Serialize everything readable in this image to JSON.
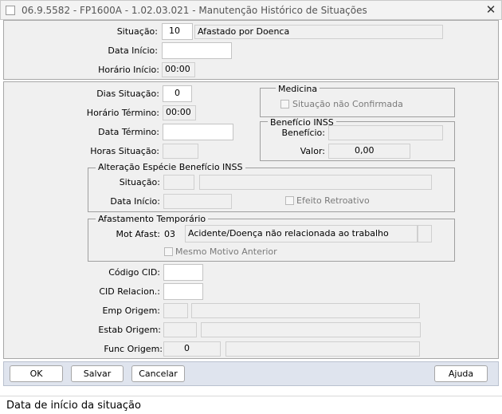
{
  "window": {
    "title": "06.9.5582 - FP1600A - 1.02.03.021 - Manutenção Histórico de Situações"
  },
  "top": {
    "situacao": {
      "label": "Situação:",
      "code": "10",
      "desc": "Afastado por Doenca"
    },
    "data_inicio": {
      "label": "Data Início:",
      "value": ""
    },
    "horario_inicio": {
      "label": "Horário Início:",
      "value": "00:00"
    }
  },
  "mid": {
    "dias_situacao": {
      "label": "Dias Situação:",
      "value": "0"
    },
    "horario_termino": {
      "label": "Horário Término:",
      "value": "00:00"
    },
    "data_termino": {
      "label": "Data Término:",
      "value": ""
    },
    "horas_situacao": {
      "label": "Horas Situação:",
      "value": ""
    },
    "medicina": {
      "title": "Medicina",
      "checkbox_label": "Situação não Confirmada",
      "checked": false
    },
    "beneficio_inss": {
      "title": "Benefício INSS",
      "beneficio": {
        "label": "Benefício:",
        "value": ""
      },
      "valor": {
        "label": "Valor:",
        "value": "0,00"
      }
    },
    "alteracao": {
      "title": "Alteração Espécie Benefício INSS",
      "situacao": {
        "label": "Situação:",
        "code": "",
        "desc": ""
      },
      "data_inicio": {
        "label": "Data Início:",
        "value": ""
      },
      "efeito_label": "Efeito Retroativo",
      "efeito_checked": false
    },
    "afastamento": {
      "title": "Afastamento Temporário",
      "mot_afast": {
        "label": "Mot Afast:",
        "code": "03",
        "desc": "Acidente/Doença não relacionada ao trabalho"
      },
      "mesmo_motivo_label": "Mesmo Motivo Anterior",
      "mesmo_motivo_checked": false
    },
    "codigo_cid": {
      "label": "Código CID:",
      "value": ""
    },
    "cid_relacion": {
      "label": "CID Relacion.:",
      "value": ""
    },
    "emp_origem": {
      "label": "Emp Origem:",
      "code": "",
      "desc": ""
    },
    "estab_origem": {
      "label": "Estab Origem:",
      "code": "",
      "desc": ""
    },
    "func_origem": {
      "label": "Func Origem:",
      "code": "0",
      "desc": ""
    }
  },
  "buttons": {
    "ok": "OK",
    "salvar": "Salvar",
    "cancelar": "Cancelar",
    "ajuda": "Ajuda"
  },
  "status_bar": {
    "text": "Data de início da situação"
  },
  "icons": {
    "close": "close-icon",
    "app": "app-icon"
  }
}
